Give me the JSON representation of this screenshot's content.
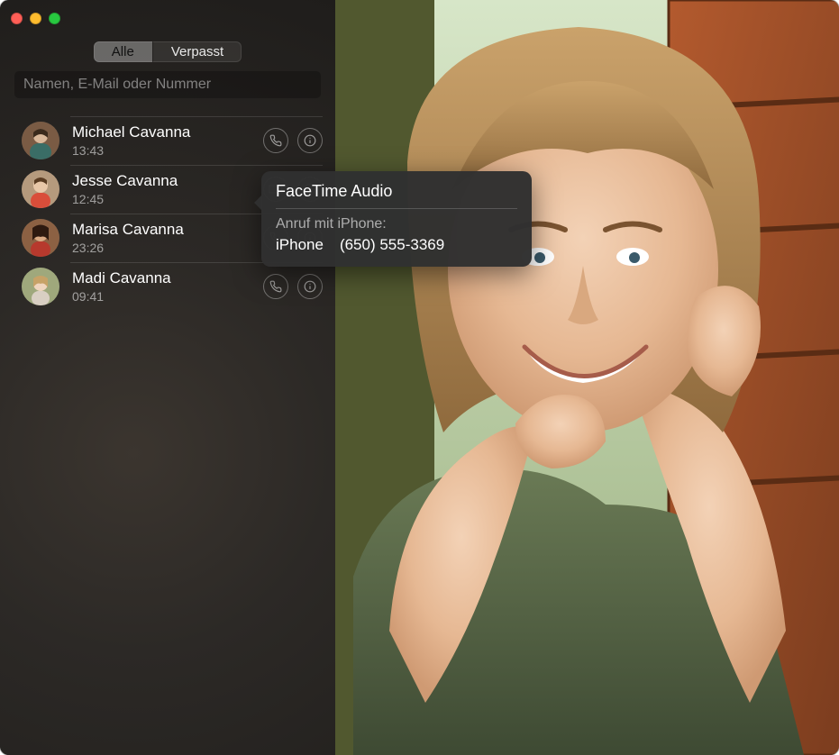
{
  "tabs": {
    "all": "Alle",
    "missed": "Verpasst",
    "active": "all"
  },
  "search": {
    "placeholder": "Namen, E-Mail oder Nummer"
  },
  "contacts": [
    {
      "name": "Michael Cavanna",
      "time": "13:43",
      "action": "phone",
      "avatar": "male1"
    },
    {
      "name": "Jesse Cavanna",
      "time": "12:45",
      "action": "video",
      "avatar": "child1"
    },
    {
      "name": "Marisa Cavanna",
      "time": "23:26",
      "action": "phone",
      "avatar": "female1"
    },
    {
      "name": "Madi Cavanna",
      "time": "09:41",
      "action": "phone",
      "avatar": "child2"
    }
  ],
  "popover": {
    "title": "FaceTime Audio",
    "subtitle": "Anruf mit iPhone:",
    "device": "iPhone",
    "number": "(650) 555-3369"
  },
  "icons": {
    "phone": "phone-icon",
    "video": "video-icon",
    "info": "info-icon"
  }
}
